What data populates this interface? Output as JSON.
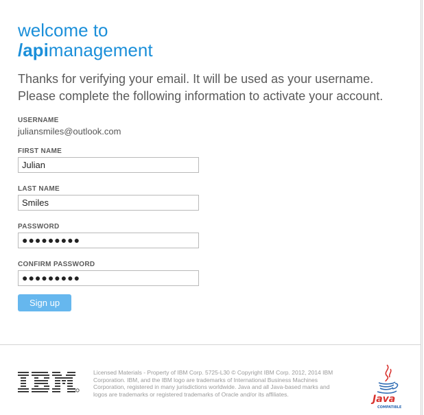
{
  "header": {
    "welcome": "welcome to",
    "brand_prefix": "/api",
    "brand_suffix": "management"
  },
  "intro": {
    "line1": "Thanks for verifying your email. It will be used as your username.",
    "line2": "Please complete the following information to activate your account."
  },
  "form": {
    "username_label": "USERNAME",
    "username_value": "juliansmiles@outlook.com",
    "first_name_label": "FIRST NAME",
    "first_name_value": "Julian",
    "last_name_label": "LAST NAME",
    "last_name_value": "Smiles",
    "password_label": "PASSWORD",
    "password_value": "●●●●●●●●●",
    "confirm_password_label": "CONFIRM PASSWORD",
    "confirm_password_value": "●●●●●●●●●",
    "signup_label": "Sign up"
  },
  "footer": {
    "ibm_logo": "IBM",
    "legal": "Licensed Materials - Property of IBM Corp. 5725-L30 © Copyright IBM Corp. 2012, 2014 IBM Corporation. IBM, and the IBM logo are trademarks of International Business Machines Corporation, registered in many jurisdictions worldwide. Java and all Java-based marks and logos are trademarks or registered trademarks of Oracle and/or its affiliates.",
    "java_logo_text": "Java",
    "java_compatible": "COMPATIBLE"
  },
  "colors": {
    "accent": "#1b8fd9",
    "button": "#66b7ee"
  }
}
